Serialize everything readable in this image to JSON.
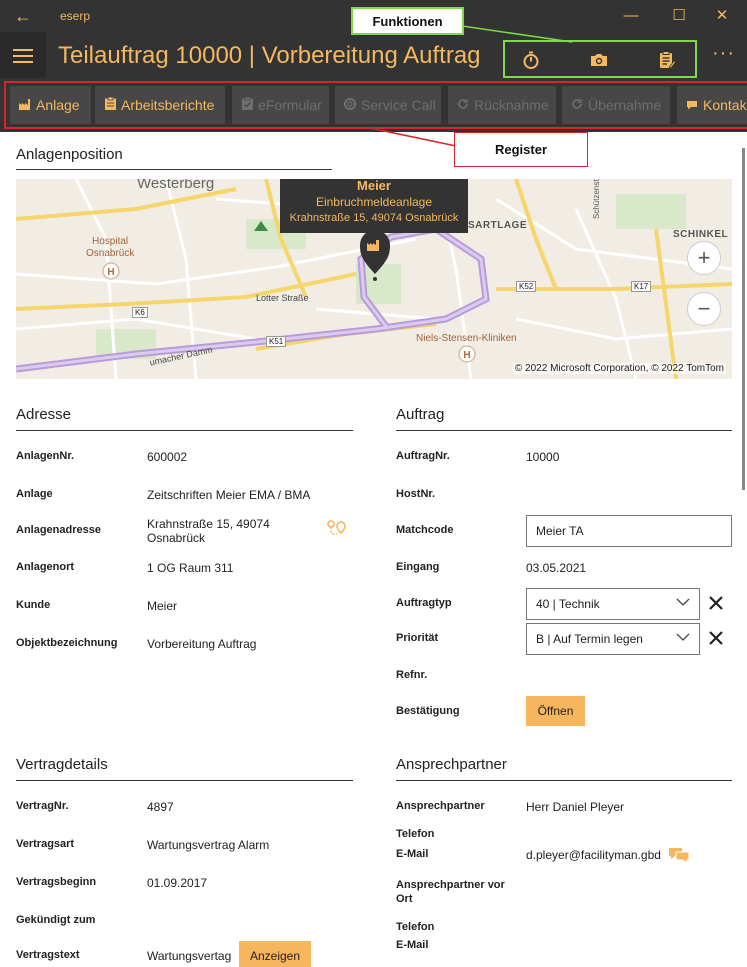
{
  "window": {
    "app_name": "eserp",
    "back_glyph": "←",
    "minimize_glyph": "—",
    "maximize_glyph": "☐",
    "close_glyph": "✕"
  },
  "header": {
    "title": "Teilauftrag 10000  |  Vorbereitung Auftrag",
    "more_glyph": "···"
  },
  "callouts": {
    "functions": "Funktionen",
    "register": "Register"
  },
  "tabs": [
    {
      "label": "Anlage",
      "icon": "factory-icon",
      "enabled": true
    },
    {
      "label": "Arbeitsberichte",
      "icon": "clipboard-icon",
      "enabled": true
    },
    {
      "label": "eFormular",
      "icon": "clipboard-check-icon",
      "enabled": false
    },
    {
      "label": "Service Call",
      "icon": "lifebuoy-icon",
      "enabled": false
    },
    {
      "label": "Rücknahme",
      "icon": "refresh-icon",
      "enabled": false
    },
    {
      "label": "Übernahme",
      "icon": "refresh-icon",
      "enabled": false
    },
    {
      "label": "Kontak",
      "icon": "chat-icon",
      "enabled": true
    }
  ],
  "anlagenposition": {
    "title": "Anlagenposition",
    "map": {
      "popup_name": "Meier",
      "popup_type": "Einbruchmeldeanlage",
      "popup_address": "Krahnstraße 15, 49074 Osnabrück",
      "labels": [
        "Westerberg",
        "Hospital",
        "Osnabrück",
        "SCHINKEL",
        "SARTLAGE",
        "Lotter Straße",
        "Niels-Stensen-Kliniken",
        "Schützenstraße",
        "umacher Damm"
      ],
      "roads": [
        "K6",
        "K51",
        "K52",
        "K17"
      ],
      "copyright": "© 2022 Microsoft Corporation, © 2022 TomTom",
      "zoom_in_glyph": "+",
      "zoom_out_glyph": "−"
    }
  },
  "adresse": {
    "title": "Adresse",
    "fields": [
      {
        "label": "AnlagenNr.",
        "value": "600002"
      },
      {
        "label": "Anlage",
        "value": "Zeitschriften Meier EMA / BMA"
      },
      {
        "label": "Anlagenadresse",
        "value": "Krahnstraße 15, 49074",
        "value2": "Osnabrück"
      },
      {
        "label": "Anlagenort",
        "value": "1 OG Raum 311"
      },
      {
        "label": "Kunde",
        "value": "Meier"
      },
      {
        "label": "Objektbezeichnung",
        "value": "Vorbereitung Auftrag"
      }
    ]
  },
  "auftrag": {
    "title": "Auftrag",
    "auftragnr_label": "AuftragNr.",
    "auftragnr": "10000",
    "hostnr_label": "HostNr.",
    "matchcode_label": "Matchcode",
    "matchcode": "Meier TA",
    "eingang_label": "Eingang",
    "eingang": "03.05.2021",
    "auftragtyp_label": "Auftragtyp",
    "auftragtyp": "40  |  Technik",
    "prioritaet_label": "Priorität",
    "prioritaet": "B  |  Auf Termin legen",
    "refnr_label": "Refnr.",
    "bestaetigung_label": "Bestätigung",
    "oeffnen_label": "Öffnen"
  },
  "vertragdetails": {
    "title": "Vertragdetails",
    "fields": [
      {
        "label": "VertragNr.",
        "value": "4897"
      },
      {
        "label": "Vertragsart",
        "value": "Wartungsvertrag Alarm"
      },
      {
        "label": "Vertragsbeginn",
        "value": "01.09.2017"
      },
      {
        "label": "Gekündigt zum",
        "value": ""
      },
      {
        "label": "Vertragstext",
        "value": "Wartungsvertag"
      }
    ],
    "anzeigen_label": "Anzeigen"
  },
  "ansprechpartner": {
    "title": "Ansprechpartner",
    "name_label": "Ansprechpartner",
    "name": "Herr Daniel Pleyer",
    "telefon_label": "Telefon",
    "email_label": "E-Mail",
    "email": "d.pleyer@facilityman.gbd",
    "vor_ort_label_1": "Ansprechpartner vor",
    "vor_ort_label_2": "Ort",
    "telefon2_label": "Telefon",
    "email2_label": "E-Mail"
  },
  "colors": {
    "accent": "#f4b860",
    "dark": "#333333",
    "tab": "#474747",
    "func_box": "#7fd94a",
    "register_box": "#d9242c"
  }
}
